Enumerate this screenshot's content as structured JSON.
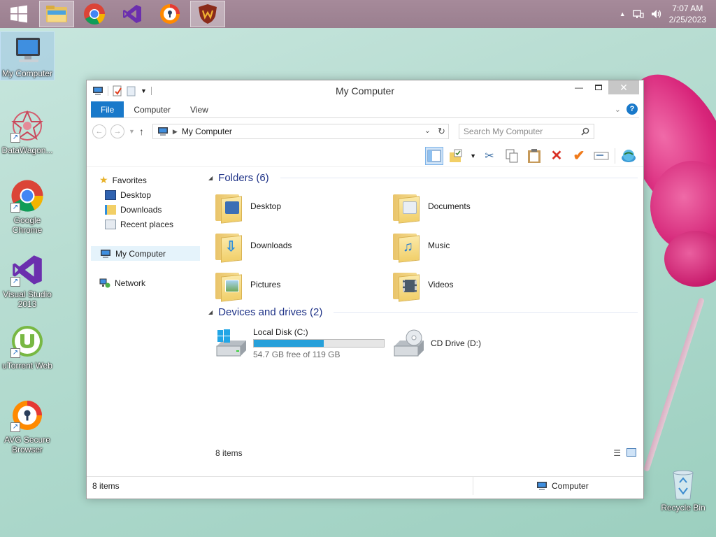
{
  "taskbar": {
    "apps": [
      {
        "name": "file-explorer",
        "active": true
      },
      {
        "name": "chrome",
        "active": false
      },
      {
        "name": "visual-studio",
        "active": false
      },
      {
        "name": "avg-browser",
        "active": false
      },
      {
        "name": "datawagon",
        "active": true
      }
    ],
    "time": "7:07 AM",
    "date": "2/25/2023"
  },
  "desktop": {
    "icons": [
      {
        "label": "My Computer"
      },
      {
        "label": "DataWagon..."
      },
      {
        "label": "Google Chrome"
      },
      {
        "label": "Visual Studio 2013"
      },
      {
        "label": "uTorrent Web"
      },
      {
        "label": "AVG Secure Browser"
      }
    ],
    "recycle_bin": "Recycle Bin"
  },
  "window": {
    "title": "My Computer",
    "ribbon_tabs": [
      "File",
      "Computer",
      "View"
    ],
    "address": "My Computer",
    "search_placeholder": "Search My Computer",
    "nav": {
      "favorites": "Favorites",
      "favorites_items": [
        "Desktop",
        "Downloads",
        "Recent places"
      ],
      "my_computer": "My Computer",
      "network": "Network"
    },
    "folders_header": "Folders (6)",
    "folders": [
      {
        "label": "Desktop",
        "badge": "#3b6fb5"
      },
      {
        "label": "Documents",
        "badge": "#e9eef5"
      },
      {
        "label": "Downloads",
        "badge": "#2f8fdd"
      },
      {
        "label": "Music",
        "badge": "#2b7fd0"
      },
      {
        "label": "Pictures",
        "badge": "#7fb7e6"
      },
      {
        "label": "Videos",
        "badge": "#4b5a6a"
      }
    ],
    "drives_header": "Devices and drives (2)",
    "drives": [
      {
        "label": "Local Disk (C:)",
        "free": "54.7 GB free of 119 GB",
        "used_fraction": 0.54
      },
      {
        "label": "CD Drive (D:)"
      }
    ],
    "items_count": "8 items",
    "status_items": "8 items",
    "status_location": "Computer"
  }
}
